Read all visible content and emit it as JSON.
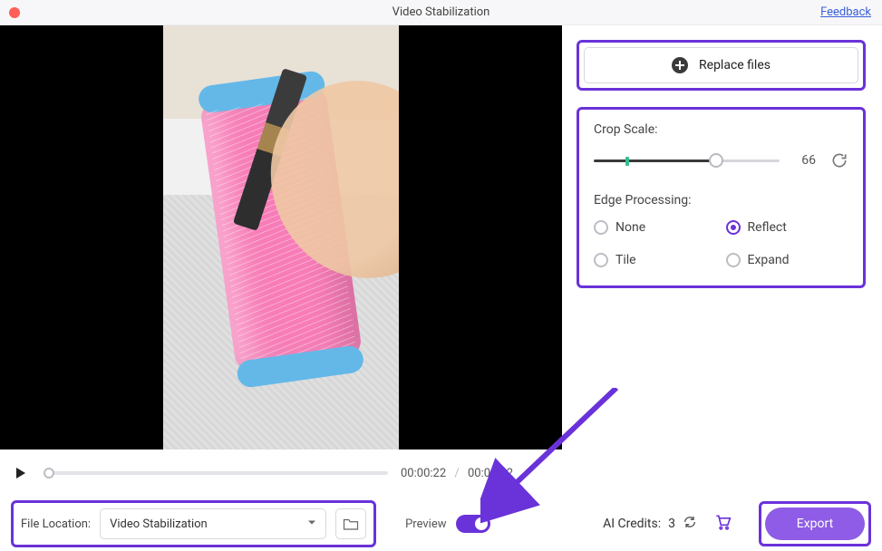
{
  "window": {
    "title": "Video Stabilization",
    "feedback_label": "Feedback"
  },
  "actions": {
    "replace_files_label": "Replace files"
  },
  "settings": {
    "crop_scale_label": "Crop Scale:",
    "crop_scale_value": "66",
    "edge_processing_label": "Edge Processing:",
    "edge_options": {
      "none": "None",
      "reflect": "Reflect",
      "tile": "Tile",
      "expand": "Expand"
    },
    "edge_selected": "reflect"
  },
  "player": {
    "current_time": "00:00:22",
    "duration": "00:00:32"
  },
  "footer": {
    "file_location_label": "File Location:",
    "file_location_value": "Video Stabilization",
    "preview_label": "Preview",
    "preview_on": true,
    "ai_credits_label": "AI Credits:",
    "ai_credits_value": "3",
    "export_label": "Export"
  }
}
